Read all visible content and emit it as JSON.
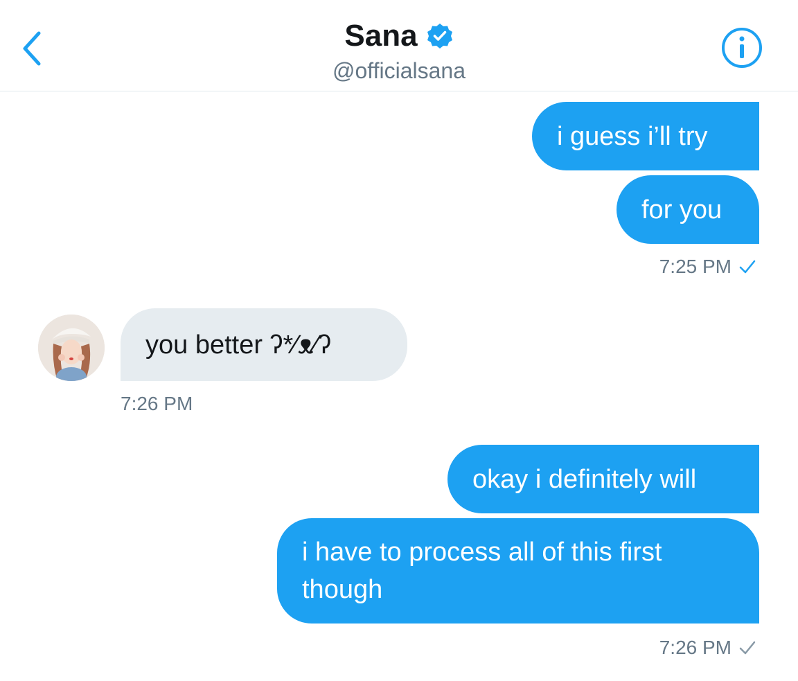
{
  "header": {
    "title": "Sana",
    "handle": "@officialsana",
    "back_icon": "chevron-left-icon",
    "info_icon": "info-circle-icon",
    "verified_icon": "verified-badge-icon"
  },
  "messages": [
    {
      "text": "i guess i’ll try",
      "direction": "outgoing"
    },
    {
      "text": "for you",
      "direction": "outgoing"
    },
    {
      "text": "you better ʔ*⁄ᴥ⁄ʔ",
      "direction": "incoming"
    },
    {
      "text": "okay i definitely will",
      "direction": "outgoing"
    },
    {
      "text": "i have to process all of this first though",
      "direction": "outgoing"
    }
  ],
  "timestamps": {
    "first": "7:25 PM",
    "incoming": "7:26 PM",
    "last": "7:26 PM"
  },
  "colors": {
    "accent": "#1da1f2",
    "incoming_bubble": "#e6ecf0",
    "muted": "#657786",
    "read_check": "#1da1f2",
    "sent_check": "#8899a6"
  }
}
